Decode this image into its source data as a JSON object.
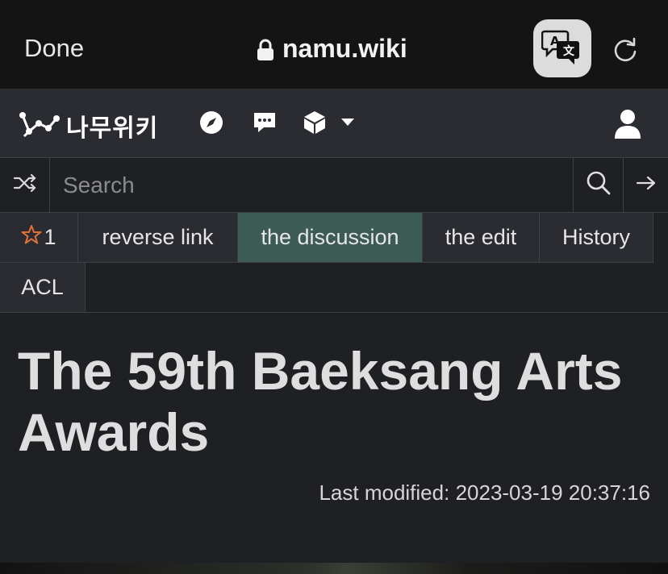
{
  "browser": {
    "done_label": "Done",
    "url": "namu.wiki",
    "icons": {
      "lock": "lock-icon",
      "translate": "translate-icon",
      "reload": "reload-icon"
    }
  },
  "wiki_nav": {
    "logo_text": "나무위키",
    "icons": [
      "compass-icon",
      "chat-icon",
      "cube-icon",
      "chevron-down-icon",
      "user-icon"
    ]
  },
  "search": {
    "placeholder": "Search",
    "icons": [
      "shuffle-icon",
      "search-icon",
      "arrow-right-icon"
    ]
  },
  "tabs": {
    "star_count": "1",
    "items": [
      {
        "label": "reverse link"
      },
      {
        "label": "the discussion"
      },
      {
        "label": "the edit"
      },
      {
        "label": "History"
      },
      {
        "label": "ACL"
      }
    ],
    "active_index": 1,
    "active_color": "#3d5b55"
  },
  "article": {
    "title": "The 59th Baeksang Arts Awards",
    "last_modified_label": "Last modified:",
    "last_modified_time": "2023-03-19 20:37:16"
  },
  "colors": {
    "safari_bar": "#141414",
    "nav_bg": "#2a2c31",
    "page_bg": "#1f2023",
    "star": "#e0703a"
  }
}
